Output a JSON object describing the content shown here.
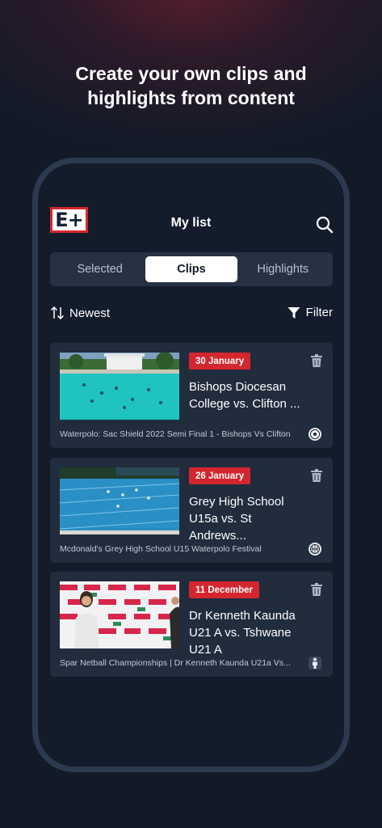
{
  "headline": {
    "line1": "Create your own clips and",
    "line2": "highlights from content"
  },
  "app": {
    "logo_text": "E+",
    "title": "My list",
    "search_icon": "search-icon"
  },
  "tabs": [
    {
      "label": "Selected",
      "active": false
    },
    {
      "label": "Clips",
      "active": true
    },
    {
      "label": "Highlights",
      "active": false
    }
  ],
  "toolbar": {
    "sort_label": "Newest",
    "filter_label": "Filter"
  },
  "colors": {
    "accent": "#d3262e",
    "card": "#212c3d",
    "background": "#131c2b"
  },
  "clips": [
    {
      "date": "30 January",
      "title": "Bishops Diocesan College vs. Clifton ...",
      "subtitle": "Waterpolo: Sac Shield 2022 Semi Final 1 - Bishops Vs Clifton",
      "sport_icon": "soccer-ball-icon"
    },
    {
      "date": "26 January",
      "title": "Grey High School U15a vs. St Andrews...",
      "subtitle": "Mcdonald's Grey High School U15 Waterpolo Festival",
      "sport_icon": "basketball-icon"
    },
    {
      "date": "11 December",
      "title": "Dr Kenneth Kaunda U21 A vs. Tshwane U21 A",
      "subtitle": "Spar Netball Championships | Dr Kenneth Kaunda U21a Vs...",
      "sport_icon": "netball-player-icon"
    }
  ]
}
